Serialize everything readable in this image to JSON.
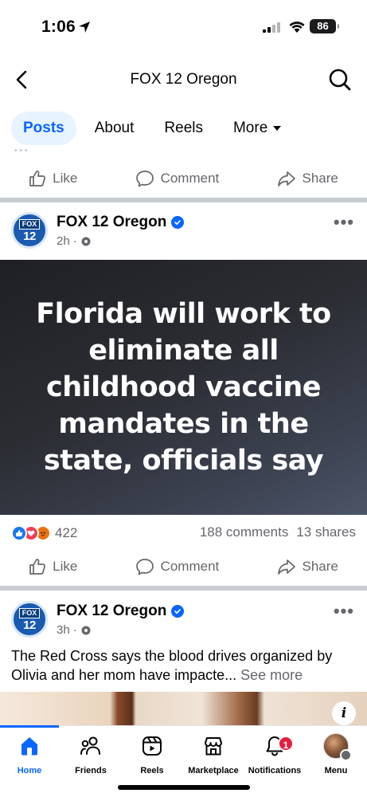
{
  "status_bar": {
    "time": "1:06",
    "battery": "86"
  },
  "header": {
    "title": "FOX 12 Oregon"
  },
  "tabs": [
    {
      "label": "Posts",
      "active": true
    },
    {
      "label": "About"
    },
    {
      "label": "Reels"
    },
    {
      "label": "More"
    }
  ],
  "actions": {
    "like": "Like",
    "comment": "Comment",
    "share": "Share"
  },
  "posts": [
    {
      "author": "FOX 12 Oregon",
      "avatar_text_top": "FOX",
      "avatar_text_num": "12",
      "time": "2h",
      "headline": "Florida will work to eliminate all childhood vaccine mandates in the state, officials say",
      "reactions_count": "422",
      "comments": "188 comments",
      "shares": "13 shares"
    },
    {
      "author": "FOX 12 Oregon",
      "avatar_text_top": "FOX",
      "avatar_text_num": "12",
      "time": "3h",
      "caption": "The Red Cross says the blood drives organized by Olivia and her mom have impacte...",
      "see_more": "See more",
      "info_label": "i"
    }
  ],
  "bottom_nav": [
    {
      "label": "Home",
      "active": true,
      "icon": "home-icon"
    },
    {
      "label": "Friends",
      "icon": "friends-icon"
    },
    {
      "label": "Reels",
      "icon": "reels-icon"
    },
    {
      "label": "Marketplace",
      "icon": "marketplace-icon"
    },
    {
      "label": "Notifications",
      "icon": "bell-icon",
      "badge": "1"
    },
    {
      "label": "Menu",
      "icon": "profile-avatar"
    }
  ],
  "colors": {
    "accent": "#0866ff",
    "badge": "#e41e3f",
    "muted": "#65676b"
  }
}
